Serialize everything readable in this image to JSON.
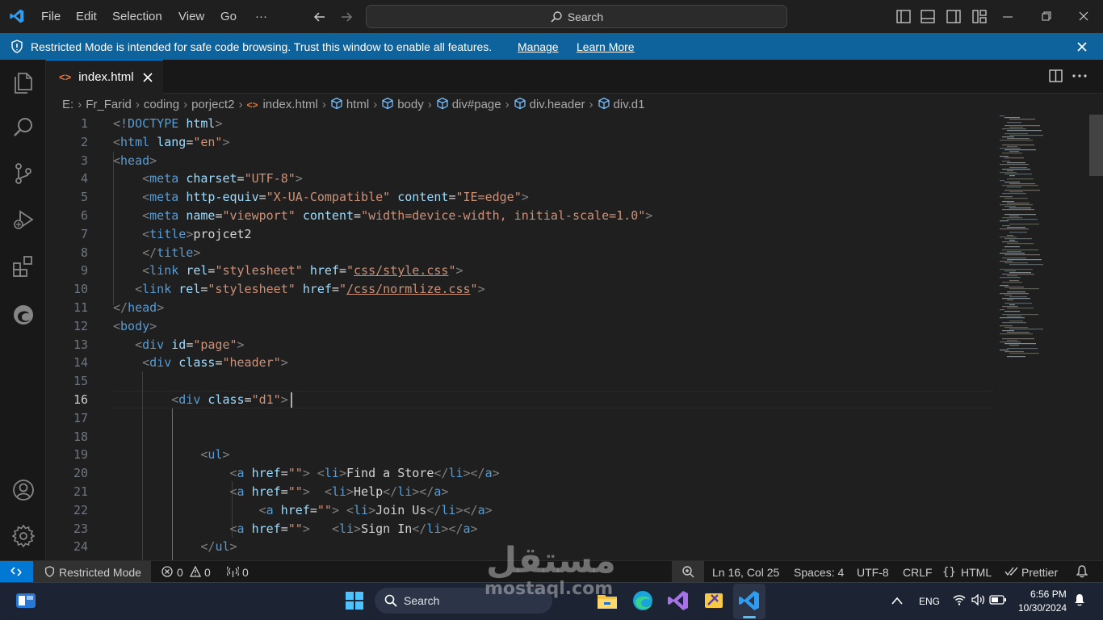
{
  "menu": {
    "items": [
      "File",
      "Edit",
      "Selection",
      "View",
      "Go"
    ],
    "more": "···"
  },
  "search": {
    "label": "Search"
  },
  "banner": {
    "text": "Restricted Mode is intended for safe code browsing. Trust this window to enable all features.",
    "manage": "Manage",
    "learn_more": "Learn More"
  },
  "tab": {
    "label": "index.html"
  },
  "breadcrumb": [
    "E:",
    "Fr_Farid",
    "coding",
    "porject2",
    "index.html",
    "html",
    "body",
    "div#page",
    "div.header",
    "div.d1"
  ],
  "editor": {
    "active_line": 16,
    "lines": [
      {
        "n": "1",
        "tokens": [
          [
            "p",
            "<"
          ],
          [
            "t",
            "!DOCTYPE"
          ],
          [
            "x",
            " "
          ],
          [
            "a",
            "html"
          ],
          [
            "p",
            ">"
          ]
        ]
      },
      {
        "n": "2",
        "tokens": [
          [
            "p",
            "<"
          ],
          [
            "t",
            "html"
          ],
          [
            "x",
            " "
          ],
          [
            "a",
            "lang"
          ],
          [
            "x",
            "="
          ],
          [
            "s",
            "\"en\""
          ],
          [
            "p",
            ">"
          ]
        ]
      },
      {
        "n": "3",
        "tokens": [
          [
            "p",
            "<"
          ],
          [
            "t",
            "head"
          ],
          [
            "p",
            ">"
          ]
        ]
      },
      {
        "n": "4",
        "tokens": [
          [
            "x",
            "    "
          ],
          [
            "p",
            "<"
          ],
          [
            "t",
            "meta"
          ],
          [
            "x",
            " "
          ],
          [
            "a",
            "charset"
          ],
          [
            "x",
            "="
          ],
          [
            "s",
            "\"UTF-8\""
          ],
          [
            "p",
            ">"
          ]
        ]
      },
      {
        "n": "5",
        "tokens": [
          [
            "x",
            "    "
          ],
          [
            "p",
            "<"
          ],
          [
            "t",
            "meta"
          ],
          [
            "x",
            " "
          ],
          [
            "a",
            "http-equiv"
          ],
          [
            "x",
            "="
          ],
          [
            "s",
            "\"X-UA-Compatible\""
          ],
          [
            "x",
            " "
          ],
          [
            "a",
            "content"
          ],
          [
            "x",
            "="
          ],
          [
            "s",
            "\"IE=edge\""
          ],
          [
            "p",
            ">"
          ]
        ]
      },
      {
        "n": "6",
        "tokens": [
          [
            "x",
            "    "
          ],
          [
            "p",
            "<"
          ],
          [
            "t",
            "meta"
          ],
          [
            "x",
            " "
          ],
          [
            "a",
            "name"
          ],
          [
            "x",
            "="
          ],
          [
            "s",
            "\"viewport\""
          ],
          [
            "x",
            " "
          ],
          [
            "a",
            "content"
          ],
          [
            "x",
            "="
          ],
          [
            "s",
            "\"width=device-width, initial-scale=1.0\""
          ],
          [
            "p",
            ">"
          ]
        ]
      },
      {
        "n": "7",
        "tokens": [
          [
            "x",
            "    "
          ],
          [
            "p",
            "<"
          ],
          [
            "t",
            "title"
          ],
          [
            "p",
            ">"
          ],
          [
            "x",
            "projcet2"
          ]
        ]
      },
      {
        "n": "8",
        "tokens": [
          [
            "x",
            "    "
          ],
          [
            "p",
            "</"
          ],
          [
            "t",
            "title"
          ],
          [
            "p",
            ">"
          ]
        ]
      },
      {
        "n": "9",
        "tokens": [
          [
            "x",
            "    "
          ],
          [
            "p",
            "<"
          ],
          [
            "t",
            "link"
          ],
          [
            "x",
            " "
          ],
          [
            "a",
            "rel"
          ],
          [
            "x",
            "="
          ],
          [
            "s",
            "\"stylesheet\""
          ],
          [
            "x",
            " "
          ],
          [
            "a",
            "href"
          ],
          [
            "x",
            "="
          ],
          [
            "s",
            "\""
          ],
          [
            "su",
            "css/style.css"
          ],
          [
            "s",
            "\""
          ],
          [
            "p",
            ">"
          ]
        ]
      },
      {
        "n": "10",
        "tokens": [
          [
            "x",
            "   "
          ],
          [
            "p",
            "<"
          ],
          [
            "t",
            "link"
          ],
          [
            "x",
            " "
          ],
          [
            "a",
            "rel"
          ],
          [
            "x",
            "="
          ],
          [
            "s",
            "\"stylesheet\""
          ],
          [
            "x",
            " "
          ],
          [
            "a",
            "href"
          ],
          [
            "x",
            "="
          ],
          [
            "s",
            "\""
          ],
          [
            "su",
            "/css/normlize.css"
          ],
          [
            "s",
            "\""
          ],
          [
            "p",
            ">"
          ]
        ]
      },
      {
        "n": "11",
        "tokens": [
          [
            "p",
            "</"
          ],
          [
            "t",
            "head"
          ],
          [
            "p",
            ">"
          ]
        ]
      },
      {
        "n": "12",
        "tokens": [
          [
            "p",
            "<"
          ],
          [
            "t",
            "body"
          ],
          [
            "p",
            ">"
          ]
        ]
      },
      {
        "n": "13",
        "tokens": [
          [
            "x",
            "   "
          ],
          [
            "p",
            "<"
          ],
          [
            "t",
            "div"
          ],
          [
            "x",
            " "
          ],
          [
            "a",
            "id"
          ],
          [
            "x",
            "="
          ],
          [
            "s",
            "\"page\""
          ],
          [
            "p",
            ">"
          ]
        ]
      },
      {
        "n": "14",
        "tokens": [
          [
            "x",
            "    "
          ],
          [
            "p",
            "<"
          ],
          [
            "t",
            "div"
          ],
          [
            "x",
            " "
          ],
          [
            "a",
            "class"
          ],
          [
            "x",
            "="
          ],
          [
            "s",
            "\"header\""
          ],
          [
            "p",
            ">"
          ]
        ]
      },
      {
        "n": "15",
        "tokens": []
      },
      {
        "n": "16",
        "tokens": [
          [
            "x",
            "        "
          ],
          [
            "p",
            "<"
          ],
          [
            "t",
            "div"
          ],
          [
            "x",
            " "
          ],
          [
            "a",
            "class"
          ],
          [
            "x",
            "="
          ],
          [
            "s",
            "\"d1\""
          ],
          [
            "p",
            ">"
          ]
        ]
      },
      {
        "n": "17",
        "tokens": []
      },
      {
        "n": "18",
        "tokens": []
      },
      {
        "n": "19",
        "tokens": [
          [
            "x",
            "            "
          ],
          [
            "p",
            "<"
          ],
          [
            "t",
            "ul"
          ],
          [
            "p",
            ">"
          ]
        ]
      },
      {
        "n": "20",
        "tokens": [
          [
            "x",
            "                "
          ],
          [
            "p",
            "<"
          ],
          [
            "t",
            "a"
          ],
          [
            "x",
            " "
          ],
          [
            "a",
            "href"
          ],
          [
            "x",
            "="
          ],
          [
            "s",
            "\"\""
          ],
          [
            "p",
            ">"
          ],
          [
            "x",
            " "
          ],
          [
            "p",
            "<"
          ],
          [
            "t",
            "li"
          ],
          [
            "p",
            ">"
          ],
          [
            "x",
            "Find a Store"
          ],
          [
            "p",
            "</"
          ],
          [
            "t",
            "li"
          ],
          [
            "p",
            "></"
          ],
          [
            "t",
            "a"
          ],
          [
            "p",
            ">"
          ]
        ]
      },
      {
        "n": "21",
        "tokens": [
          [
            "x",
            "                "
          ],
          [
            "p",
            "<"
          ],
          [
            "t",
            "a"
          ],
          [
            "x",
            " "
          ],
          [
            "a",
            "href"
          ],
          [
            "x",
            "="
          ],
          [
            "s",
            "\"\""
          ],
          [
            "p",
            ">"
          ],
          [
            "x",
            "  "
          ],
          [
            "p",
            "<"
          ],
          [
            "t",
            "li"
          ],
          [
            "p",
            ">"
          ],
          [
            "x",
            "Help"
          ],
          [
            "p",
            "</"
          ],
          [
            "t",
            "li"
          ],
          [
            "p",
            "></"
          ],
          [
            "t",
            "a"
          ],
          [
            "p",
            ">"
          ]
        ]
      },
      {
        "n": "22",
        "tokens": [
          [
            "x",
            "                    "
          ],
          [
            "p",
            "<"
          ],
          [
            "t",
            "a"
          ],
          [
            "x",
            " "
          ],
          [
            "a",
            "href"
          ],
          [
            "x",
            "="
          ],
          [
            "s",
            "\"\""
          ],
          [
            "p",
            ">"
          ],
          [
            "x",
            " "
          ],
          [
            "p",
            "<"
          ],
          [
            "t",
            "li"
          ],
          [
            "p",
            ">"
          ],
          [
            "x",
            "Join Us"
          ],
          [
            "p",
            "</"
          ],
          [
            "t",
            "li"
          ],
          [
            "p",
            "></"
          ],
          [
            "t",
            "a"
          ],
          [
            "p",
            ">"
          ]
        ]
      },
      {
        "n": "23",
        "tokens": [
          [
            "x",
            "                "
          ],
          [
            "p",
            "<"
          ],
          [
            "t",
            "a"
          ],
          [
            "x",
            " "
          ],
          [
            "a",
            "href"
          ],
          [
            "x",
            "="
          ],
          [
            "s",
            "\"\""
          ],
          [
            "p",
            ">"
          ],
          [
            "x",
            "   "
          ],
          [
            "p",
            "<"
          ],
          [
            "t",
            "li"
          ],
          [
            "p",
            ">"
          ],
          [
            "x",
            "Sign In"
          ],
          [
            "p",
            "</"
          ],
          [
            "t",
            "li"
          ],
          [
            "p",
            "></"
          ],
          [
            "t",
            "a"
          ],
          [
            "p",
            ">"
          ]
        ]
      },
      {
        "n": "24",
        "tokens": [
          [
            "x",
            "            "
          ],
          [
            "p",
            "</"
          ],
          [
            "t",
            "ul"
          ],
          [
            "p",
            ">"
          ]
        ]
      }
    ]
  },
  "status": {
    "restricted": "Restricted Mode",
    "errors": "0",
    "warnings": "0",
    "ports": "0",
    "position": "Ln 16, Col 25",
    "spaces": "Spaces: 4",
    "encoding": "UTF-8",
    "eol": "CRLF",
    "language": "HTML",
    "prettier": "Prettier"
  },
  "taskbar": {
    "search": "Search",
    "lang": "ENG",
    "time": "6:56 PM",
    "date": "10/30/2024"
  },
  "watermark": {
    "arabic": "مستقل",
    "latin": "mostaql.com"
  },
  "colors": {
    "accent": "#0078d4",
    "banner": "#0e639c",
    "tag": "#569cd6",
    "attr": "#9cdcfe",
    "string": "#ce9178"
  }
}
